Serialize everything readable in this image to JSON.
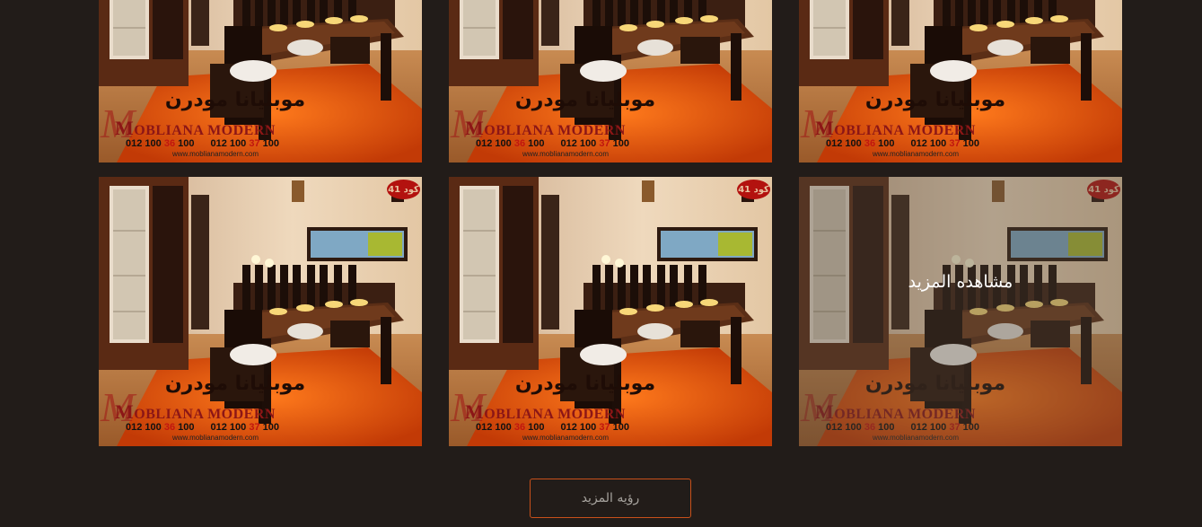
{
  "gallery": {
    "rows": [
      {
        "items": [
          {
            "badge": "",
            "show_overlay": false
          },
          {
            "badge": "",
            "show_overlay": false
          },
          {
            "badge": "",
            "show_overlay": false
          }
        ]
      },
      {
        "items": [
          {
            "badge": "كود 41",
            "show_overlay": false
          },
          {
            "badge": "كود 41",
            "show_overlay": false
          },
          {
            "badge": "كود 41",
            "show_overlay": true
          }
        ]
      }
    ],
    "watermark": {
      "arabic_brand": "موبليانا مودرن",
      "latin_initial": "M",
      "latin_brand": "OBLIANA MODERN",
      "phone_1_prefix": "012 100 ",
      "phone_1_highlight": "36",
      "phone_1_suffix": " 100",
      "phone_2_prefix": "012 100 ",
      "phone_2_highlight": "37",
      "phone_2_suffix": " 100",
      "website": "www.moblianamodern.com"
    },
    "overlay_label": "مشاهده المزيد"
  },
  "load_more": {
    "label": "رؤيه المزيد"
  },
  "colors": {
    "background": "#221c19",
    "accent_border": "#c8501a",
    "badge": "#b3120f",
    "rug": "#e0520e"
  }
}
